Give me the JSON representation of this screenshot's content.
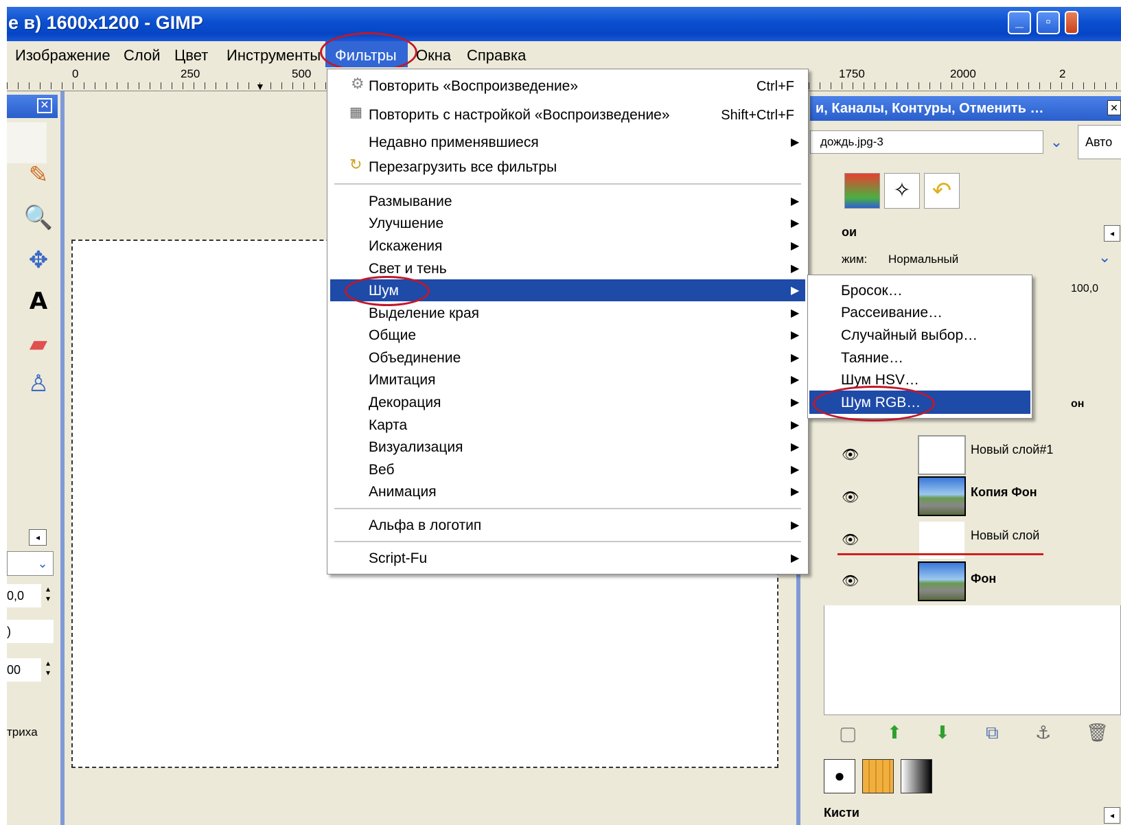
{
  "window": {
    "title": "е в) 1600x1200 - GIMP"
  },
  "menubar": {
    "items": [
      "Изображение",
      "Слой",
      "Цвет",
      "Инструменты",
      "Фильтры",
      "Окна",
      "Справка"
    ]
  },
  "ruler": {
    "ticks": [
      "0",
      "250",
      "500",
      "1750",
      "2000",
      "2"
    ]
  },
  "filters_menu": {
    "repeat": {
      "label": "Повторить «Воспроизведение»",
      "shortcut": "Ctrl+F"
    },
    "reshow": {
      "label": "Повторить с настройкой «Воспроизведение»",
      "shortcut": "Shift+Ctrl+F"
    },
    "recent": "Недавно применявшиеся",
    "reload": "Перезагрузить все фильтры",
    "categories": [
      "Размывание",
      "Улучшение",
      "Искажения",
      "Свет и тень",
      "Шум",
      "Выделение края",
      "Общие",
      "Объединение",
      "Имитация",
      "Декорация",
      "Карта",
      "Визуализация",
      "Веб",
      "Анимация"
    ],
    "alpha_logo": "Альфа в логотип",
    "script_fu": "Script-Fu"
  },
  "noise_submenu": {
    "items": [
      "Бросок…",
      "Рассеивание…",
      "Случайный выбор…",
      "Таяние…",
      "Шум HSV…",
      "Шум RGB…"
    ]
  },
  "dock": {
    "title": "и, Каналы, Контуры, Отменить …",
    "image_select": "дождь.jpg-3",
    "auto_button": "Авто",
    "layers_label": "ои",
    "mode_label": "жим:",
    "mode_value": "Нормальный",
    "opacity_value": "100,0",
    "partial_layer": "он",
    "layers": [
      "Новый слой#1",
      "Копия Фон",
      "Новый слой",
      "Фон"
    ],
    "brushes_label": "Кисти"
  },
  "toolbox": {
    "field1": "0,0",
    "field2": ")",
    "field3": "00",
    "label": "трихa"
  },
  "colors": {
    "menu_highlight": "#1e4aa8",
    "callout_ring": "#c0182a",
    "titlebar": "#0a4fd0",
    "panel_bg": "#ece9d8"
  }
}
